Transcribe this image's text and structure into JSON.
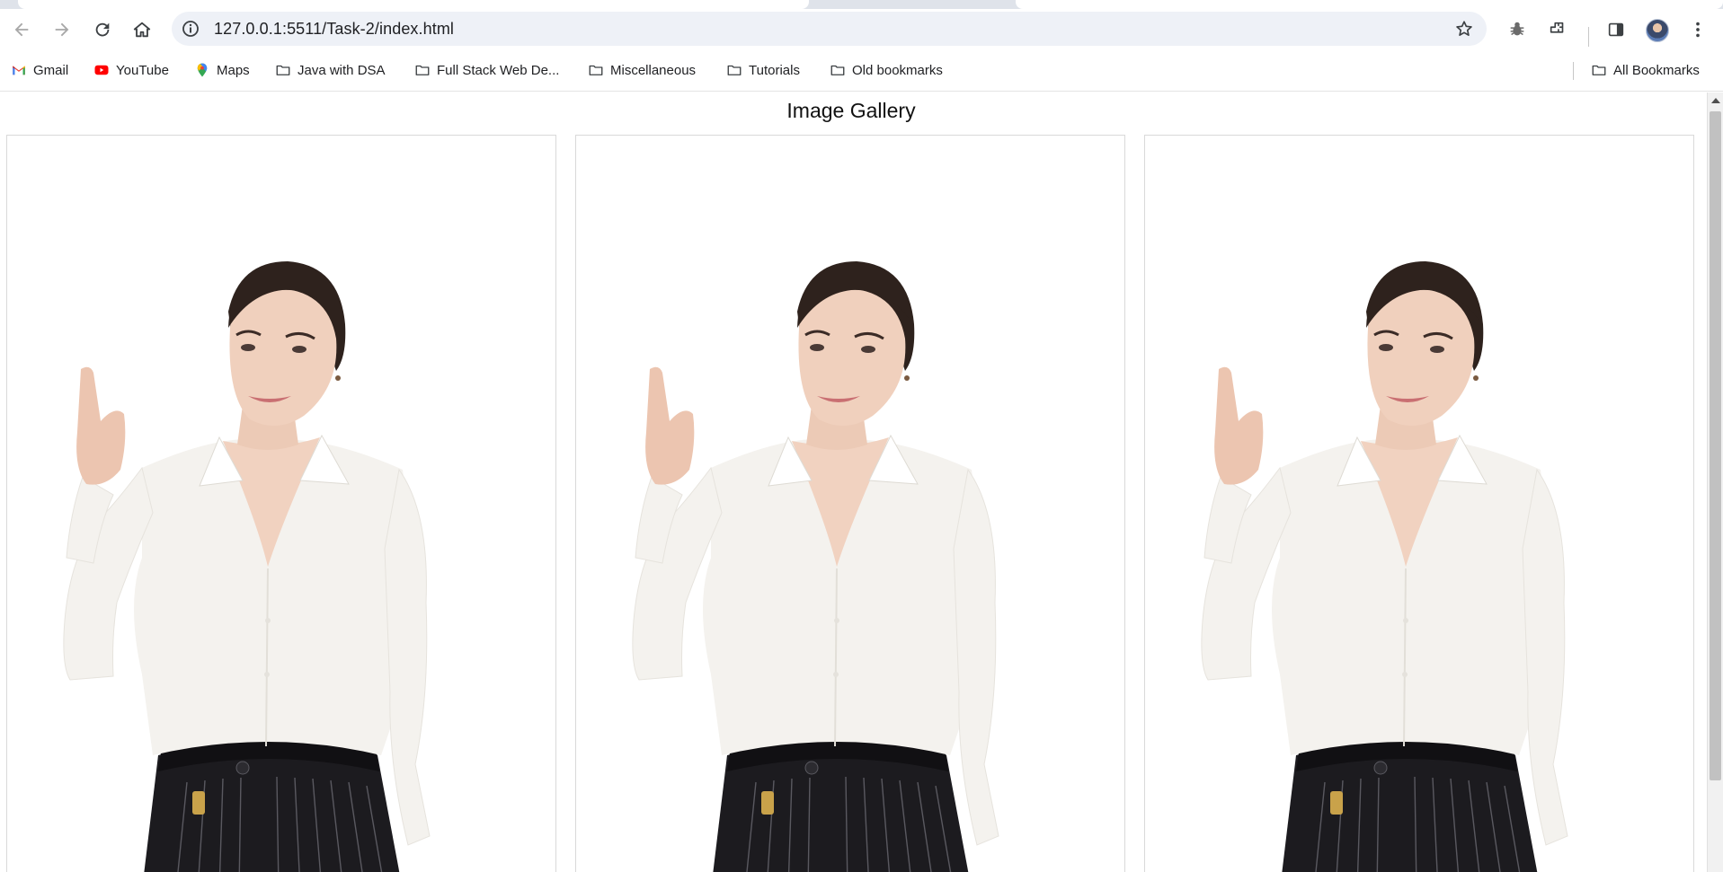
{
  "browser": {
    "url": "127.0.0.1:5511/Task-2/index.html",
    "bookmarks": [
      {
        "label": "Gmail",
        "icon": "gmail-icon"
      },
      {
        "label": "YouTube",
        "icon": "youtube-icon"
      },
      {
        "label": "Maps",
        "icon": "maps-icon"
      },
      {
        "label": "Java with DSA",
        "icon": "folder-icon"
      },
      {
        "label": "Full Stack Web De...",
        "icon": "folder-icon"
      },
      {
        "label": "Miscellaneous",
        "icon": "folder-icon"
      },
      {
        "label": "Tutorials",
        "icon": "folder-icon"
      },
      {
        "label": "Old bookmarks",
        "icon": "folder-icon"
      }
    ],
    "all_bookmarks_label": "All Bookmarks"
  },
  "page": {
    "title": "Image Gallery",
    "gallery": [
      {
        "subject": "woman in white blouse pointing up"
      },
      {
        "subject": "woman in white blouse pointing up"
      },
      {
        "subject": "woman in white blouse pointing up"
      }
    ]
  },
  "colors": {
    "chrome_bg": "#dfe3ea",
    "omnibox_bg": "#eef1f7",
    "card_border": "#d9d9d9",
    "scroll_thumb": "#c1c1c1"
  }
}
